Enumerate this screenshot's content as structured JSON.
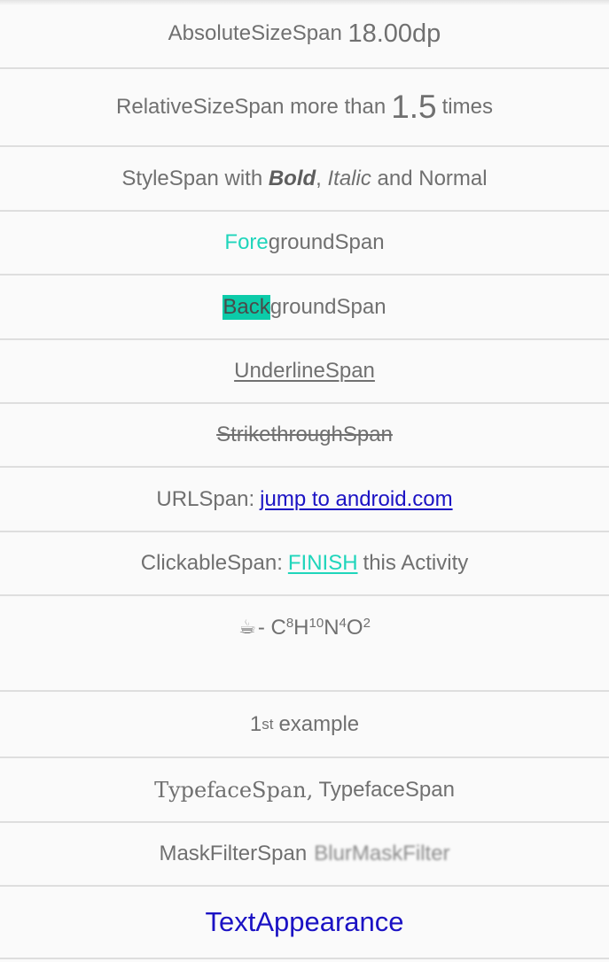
{
  "rows": {
    "absolute": {
      "prefix": "AbsoluteSizeSpan ",
      "value": "18.00dp"
    },
    "relative": {
      "prefix": "RelativeSizeSpan more than",
      "value": "1.5",
      "suffix": "times"
    },
    "style": {
      "prefix": "StyleSpan with ",
      "bold": "Bold",
      "sep": ", ",
      "italic": "Italic",
      "suffix": " and Normal"
    },
    "foreground": {
      "colored": "Fore",
      "rest": "groundSpan"
    },
    "background": {
      "highlighted": "Back",
      "rest": "groundSpan"
    },
    "underline": {
      "text": "UnderlineSpan"
    },
    "strikethrough": {
      "text": "StrikethroughSpan"
    },
    "url": {
      "prefix": "URLSpan:",
      "link": "jump to android.com"
    },
    "clickable": {
      "prefix": "ClickableSpan:",
      "link": "FINISH",
      "suffix": "this Activity"
    },
    "formula": {
      "icon": "☕",
      "dash": "- ",
      "c": "C",
      "c_sub": "8",
      "h": "H",
      "h_sub": "10",
      "n": "N",
      "n_sub": "4",
      "o": "O",
      "o_sub": "2"
    },
    "superscript": {
      "base": "1",
      "sup": "st",
      "text": "example"
    },
    "typeface": {
      "serif_part": "TypefaceSpan,",
      "sans_part": " TypefaceSpan"
    },
    "maskfilter": {
      "prefix": "MaskFilterSpan",
      "blurred": "BlurMaskFilter"
    },
    "textappearance": {
      "text": "TextAppearance"
    }
  },
  "colors": {
    "accent": "#1fd5bb",
    "highlight": "#0ccba9",
    "link": "#1b12c4",
    "divider": "#dedede",
    "text": "#707070"
  }
}
